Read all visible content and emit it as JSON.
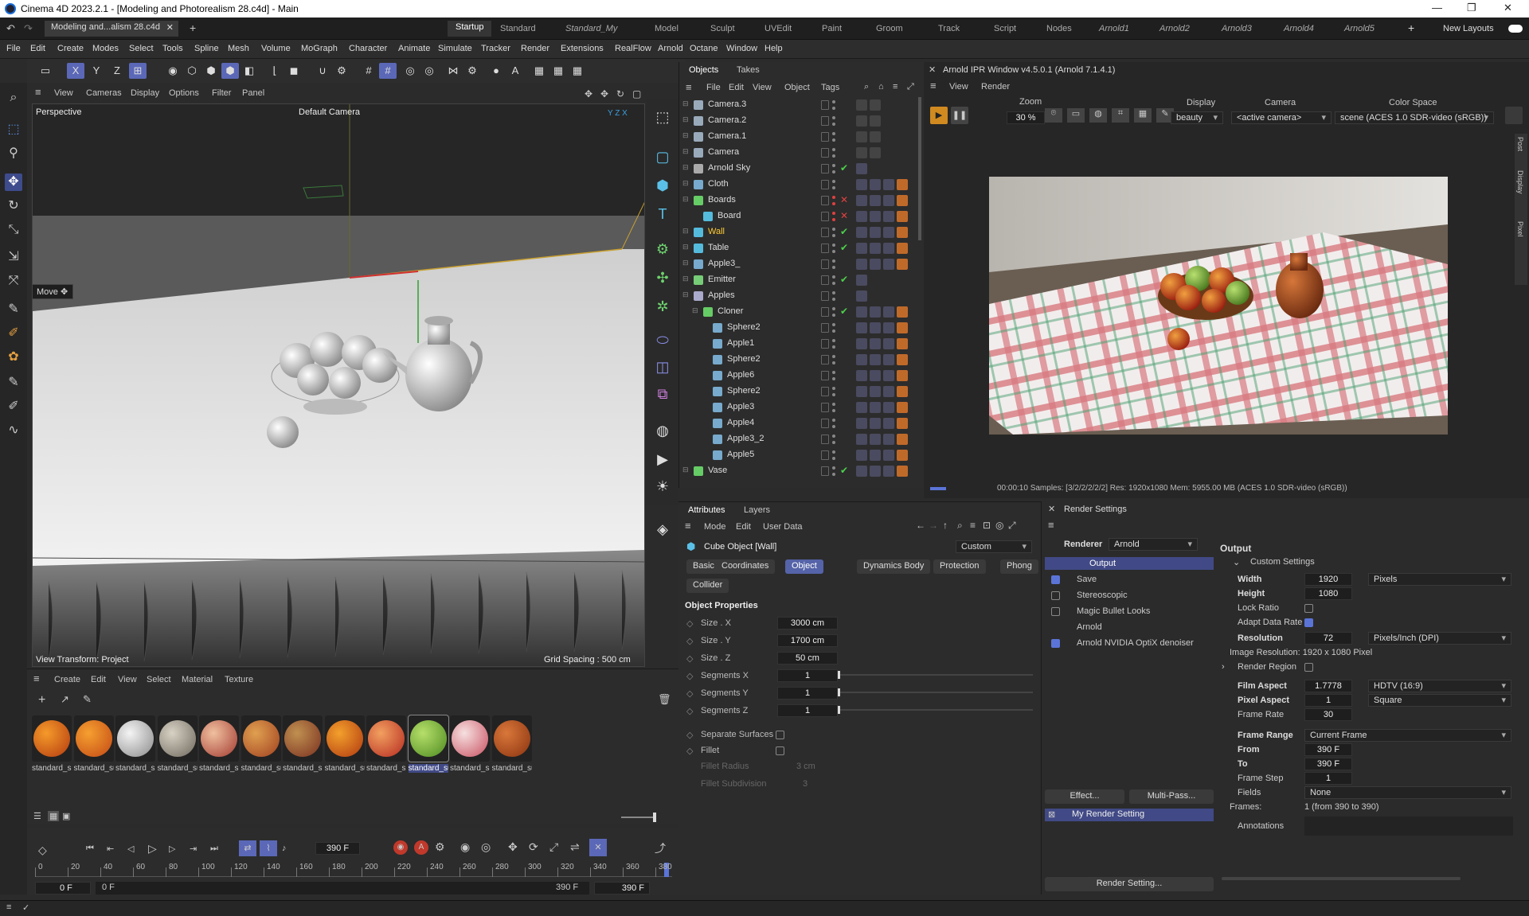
{
  "titlebar": {
    "title": "Cinema 4D 2023.2.1 - [Modeling and Photorealism 28.c4d] - Main",
    "min": "—",
    "max": "❐",
    "close": "✕"
  },
  "tabs": {
    "doc": "Modeling and...alism 28.c4d",
    "close": "✕",
    "add": "+",
    "layouts": [
      "Startup",
      "Standard",
      "Standard_My",
      "Model",
      "Sculpt",
      "UVEdit",
      "Paint",
      "Groom",
      "Track",
      "Script",
      "Nodes",
      "Arnold1",
      "Arnold2",
      "Arnold3",
      "Arnold4",
      "Arnold5"
    ],
    "plus": "+",
    "new_layouts": "New Layouts"
  },
  "menu": [
    "File",
    "Edit",
    "Create",
    "Modes",
    "Select",
    "Tools",
    "Spline",
    "Mesh",
    "Volume",
    "MoGraph",
    "Character",
    "Animate",
    "Simulate",
    "Tracker",
    "Render",
    "Extensions",
    "RealFlow",
    "Arnold",
    "Octane",
    "Window",
    "Help"
  ],
  "toolbar": {
    "axis": [
      "X",
      "Y",
      "Z"
    ]
  },
  "viewport": {
    "menu": [
      "View",
      "Cameras",
      "Display",
      "Options",
      "Filter",
      "Panel"
    ],
    "name": "Perspective",
    "camera": "Default Camera",
    "tool": "Move",
    "transform": "View Transform: Project",
    "grid": "Grid Spacing : 500 cm"
  },
  "objects": {
    "tabs": [
      "Objects",
      "Takes"
    ],
    "menu": [
      "File",
      "Edit",
      "View",
      "Object",
      "Tags"
    ],
    "rows": [
      {
        "name": "Camera.3",
        "indent": 0,
        "check": "",
        "color": "#9ab"
      },
      {
        "name": "Camera.2",
        "indent": 0,
        "check": "",
        "color": "#9ab"
      },
      {
        "name": "Camera.1",
        "indent": 0,
        "check": "",
        "color": "#9ab"
      },
      {
        "name": "Camera",
        "indent": 0,
        "check": "",
        "color": "#9ab"
      },
      {
        "name": "Arnold Sky",
        "indent": 0,
        "check": "✔",
        "color": "#aaa"
      },
      {
        "name": "Cloth",
        "indent": 0,
        "check": "",
        "color": "#7ac"
      },
      {
        "name": "Boards",
        "indent": 0,
        "check": "✕",
        "color": "#6c6"
      },
      {
        "name": "Board",
        "indent": 1,
        "check": "✕",
        "color": "#5bd"
      },
      {
        "name": "Wall",
        "indent": 0,
        "check": "✔",
        "color": "#5bd",
        "sel": true
      },
      {
        "name": "Table",
        "indent": 0,
        "check": "✔",
        "color": "#5bd"
      },
      {
        "name": "Apple3_",
        "indent": 0,
        "check": "",
        "color": "#7ac"
      },
      {
        "name": "Emitter",
        "indent": 0,
        "check": "✔",
        "color": "#7c7"
      },
      {
        "name": "Apples",
        "indent": 0,
        "check": "",
        "color": "#aac"
      },
      {
        "name": "Cloner",
        "indent": 1,
        "check": "✔",
        "color": "#6c6"
      },
      {
        "name": "Sphere2",
        "indent": 2,
        "check": "",
        "color": "#7ac"
      },
      {
        "name": "Apple1",
        "indent": 2,
        "check": "",
        "color": "#7ac"
      },
      {
        "name": "Sphere2",
        "indent": 2,
        "check": "",
        "color": "#7ac"
      },
      {
        "name": "Apple6",
        "indent": 2,
        "check": "",
        "color": "#7ac"
      },
      {
        "name": "Sphere2",
        "indent": 2,
        "check": "",
        "color": "#7ac"
      },
      {
        "name": "Apple3",
        "indent": 2,
        "check": "",
        "color": "#7ac"
      },
      {
        "name": "Apple4",
        "indent": 2,
        "check": "",
        "color": "#7ac"
      },
      {
        "name": "Apple3_2",
        "indent": 2,
        "check": "",
        "color": "#7ac"
      },
      {
        "name": "Apple5",
        "indent": 2,
        "check": "",
        "color": "#7ac"
      },
      {
        "name": "Vase",
        "indent": 0,
        "check": "✔",
        "color": "#6c6"
      }
    ]
  },
  "ipr": {
    "title": "Arnold IPR Window v4.5.0.1 (Arnold 7.1.4.1)",
    "menu": [
      "View",
      "Render"
    ],
    "zoom_label": "Zoom",
    "zoom": "30 %",
    "display_label": "Display",
    "display": "beauty",
    "camera_label": "Camera",
    "camera": "<active camera>",
    "cs_label": "Color Space",
    "cs": "scene (ACES 1.0 SDR-video (sRGB))",
    "status": "00:00:10  Samples: [3/2/2/2/2/2]  Res: 1920x1080  Mem: 5955.00 MB  (ACES 1.0 SDR-video (sRGB))",
    "side_tabs": [
      "Post",
      "Display",
      "Pixel"
    ]
  },
  "attributes": {
    "tabs": [
      "Attributes",
      "Layers"
    ],
    "menu": [
      "Mode",
      "Edit",
      "User Data"
    ],
    "object": "Cube Object [Wall]",
    "preset": "Custom",
    "buttons": [
      "Basic",
      "Coordinates",
      "Object",
      "Dynamics Body",
      "Protection",
      "Phong",
      "Collider"
    ],
    "section": "Object Properties",
    "props": [
      {
        "label": "Size . X",
        "value": "3000 cm"
      },
      {
        "label": "Size . Y",
        "value": "1700 cm"
      },
      {
        "label": "Size . Z",
        "value": "50 cm"
      },
      {
        "label": "Segments X",
        "value": "1"
      },
      {
        "label": "Segments Y",
        "value": "1"
      },
      {
        "label": "Segments Z",
        "value": "1"
      }
    ],
    "separate": "Separate Surfaces",
    "fillet": "Fillet",
    "fillet_radius": "Fillet Radius",
    "fillet_radius_v": "3 cm",
    "fillet_sub": "Fillet Subdivision",
    "fillet_sub_v": "3"
  },
  "render": {
    "title": "Render Settings",
    "renderer_label": "Renderer",
    "renderer": "Arnold",
    "list": [
      "Output",
      "Save",
      "Stereoscopic",
      "Magic Bullet Looks",
      "Arnold",
      "Arnold NVIDIA OptiX denoiser"
    ],
    "effect": "Effect...",
    "multipass": "Multi-Pass...",
    "setting": "My Render Setting",
    "setting_btn": "Render Setting...",
    "out_title": "Output",
    "custom": "Custom Settings",
    "width_l": "Width",
    "width": "1920",
    "width_u": "Pixels",
    "height_l": "Height",
    "height": "1080",
    "lock": "Lock Ratio",
    "adapt": "Adapt Data Rate",
    "res_l": "Resolution",
    "res": "72",
    "res_u": "Pixels/Inch (DPI)",
    "imgres": "Image Resolution:  1920 x 1080 Pixel",
    "region": "Render Region",
    "film_l": "Film Aspect",
    "film": "1.7778",
    "film_u": "HDTV (16:9)",
    "pix_l": "Pixel Aspect",
    "pix": "1",
    "pix_u": "Square",
    "fr_l": "Frame Rate",
    "fr": "30",
    "range_l": "Frame Range",
    "range": "Current Frame",
    "from_l": "From",
    "from": "390 F",
    "to_l": "To",
    "to": "390 F",
    "step_l": "Frame Step",
    "step": "1",
    "fields_l": "Fields",
    "fields": "None",
    "frames": "Frames:",
    "frames_v": "1 (from 390 to 390)",
    "annot": "Annotations"
  },
  "materials": {
    "menu": [
      "Create",
      "Edit",
      "View",
      "Select",
      "Material",
      "Texture"
    ],
    "items": [
      {
        "name": "standard_su",
        "c1": "#f59a2a",
        "c2": "#b33a10"
      },
      {
        "name": "standard_su",
        "c1": "#f6a030",
        "c2": "#c24815"
      },
      {
        "name": "standard_su",
        "c1": "#f4f4f4",
        "c2": "#8a8a8a"
      },
      {
        "name": "standard_su",
        "c1": "#d8d2c5",
        "c2": "#6e675c"
      },
      {
        "name": "standard_su",
        "c1": "#f0c0a0",
        "c2": "#a23a30"
      },
      {
        "name": "standard_su",
        "c1": "#e0a050",
        "c2": "#a04020"
      },
      {
        "name": "standard_su",
        "c1": "#c09050",
        "c2": "#7a3020"
      },
      {
        "name": "standard_su",
        "c1": "#f3a02c",
        "c2": "#b03810"
      },
      {
        "name": "standard_su",
        "c1": "#f2a060",
        "c2": "#b52a20"
      },
      {
        "name": "standard_su",
        "c1": "#b6df6a",
        "c2": "#4d8a20",
        "sel": true
      },
      {
        "name": "standard_su",
        "c1": "#f6e0e0",
        "c2": "#c85060"
      },
      {
        "name": "standard_su",
        "c1": "#d9773a",
        "c2": "#8a3310"
      }
    ]
  },
  "timeline": {
    "frame": "390 F",
    "ruler": [
      "0",
      "20",
      "40",
      "60",
      "80",
      "100",
      "120",
      "140",
      "160",
      "180",
      "200",
      "220",
      "240",
      "260",
      "280",
      "300",
      "320",
      "340",
      "360",
      "380"
    ],
    "start": "0 F",
    "start2": "0 F",
    "end": "390 F",
    "end2": "390 F"
  }
}
